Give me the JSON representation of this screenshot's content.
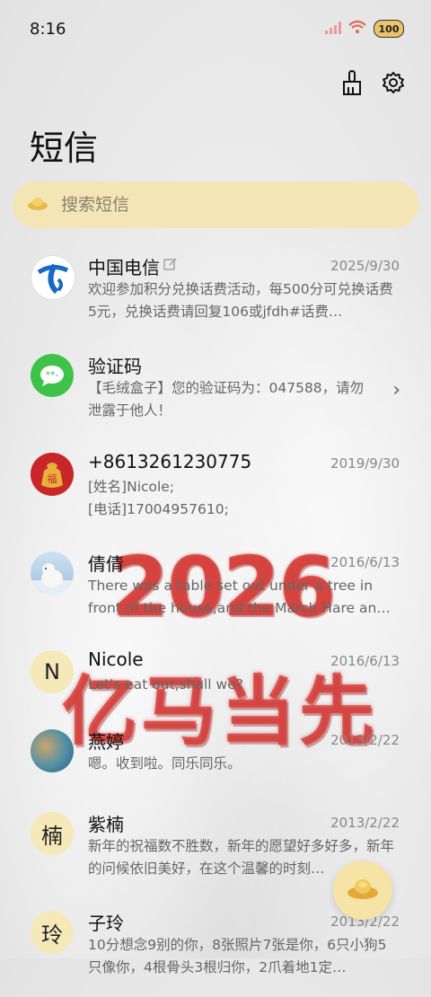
{
  "status": {
    "time": "8:16",
    "battery": "100"
  },
  "header": {
    "title": "短信"
  },
  "search": {
    "placeholder": "搜索短信"
  },
  "background_art": {
    "year": "2026",
    "slogan": "亿马当先"
  },
  "conversations": [
    {
      "name": "中国电信",
      "date": "2025/9/30",
      "preview": "欢迎参加积分兑换话费活动，每500分可兑换话费5元，兑换话费请回复106或jfdh#话费…",
      "avatar": "china-telecom-logo-icon"
    },
    {
      "name": "验证码",
      "date": "",
      "preview": "【毛绒盒子】您的验证码为：047588，请勿泄露于他人！",
      "avatar": "message-bubble-icon"
    },
    {
      "name": "+8613261230775",
      "date": "2019/9/30",
      "preview_lines": [
        "[姓名]Nicole;",
        "[电话]17004957610;"
      ],
      "avatar": "lucky-bag-icon"
    },
    {
      "name": "倩倩",
      "date": "2016/6/13",
      "preview": "There was a table set out under a tree in front of the house,and the March Hare an…",
      "avatar": "polar-bear-photo"
    },
    {
      "name": "Nicole",
      "date": "2016/6/13",
      "preview": "Let's eat out,shall we?",
      "avatar_letter": "N"
    },
    {
      "name": "燕婷",
      "date": "2013/2/22",
      "preview": "嗯。收到啦。同乐同乐。",
      "avatar": "landscape-photo"
    },
    {
      "name": "紫楠",
      "date": "2013/2/22",
      "preview": "新年的祝福数不胜数，新年的愿望好多好多，新年的问候依旧美好，在这个温馨的时刻…",
      "avatar_letter": "楠"
    },
    {
      "name": "子玲",
      "date": "2013/2/22",
      "preview": "10分想念9别的你，8张照片7张是你，6只小狗5只像你，4根骨头3根归你，2爪着地1定…",
      "avatar_letter": "玲"
    }
  ],
  "colors": {
    "search_bg": "#f4e6b4",
    "fab_bg": "#f6e4a6",
    "telecom_blue": "#1769c4",
    "message_green": "#3fc24a"
  }
}
